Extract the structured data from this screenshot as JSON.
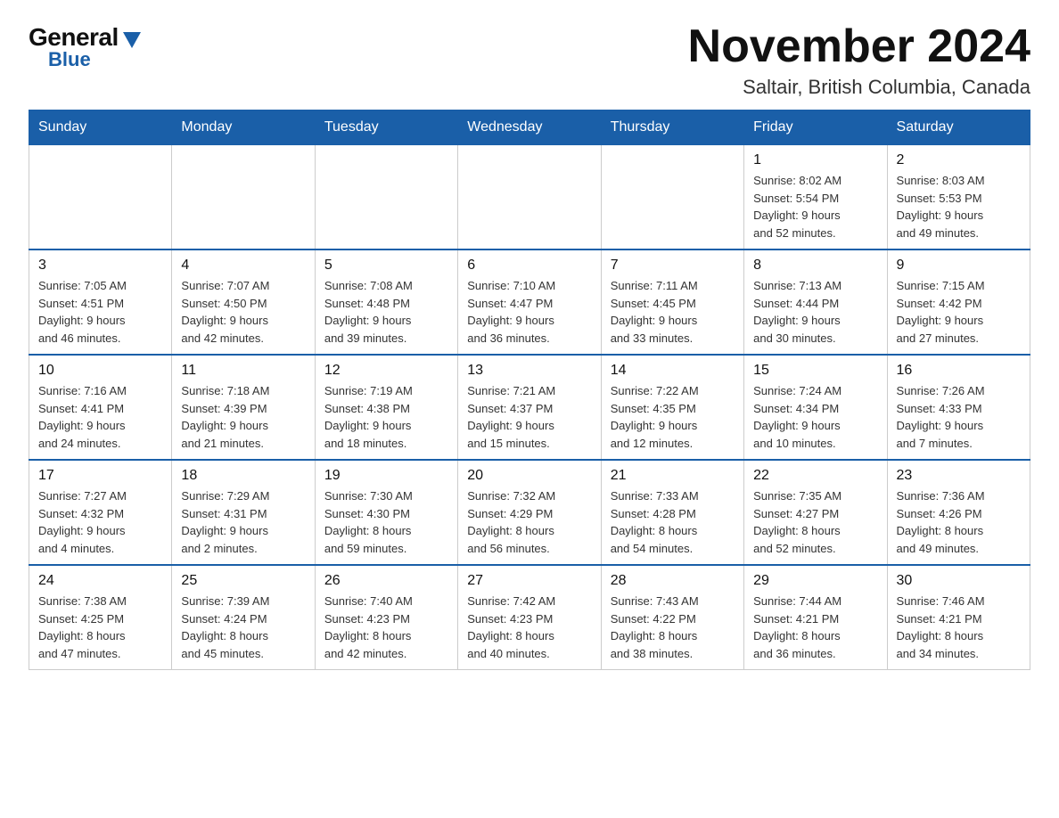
{
  "logo": {
    "general": "General",
    "blue": "Blue"
  },
  "title": {
    "month": "November 2024",
    "location": "Saltair, British Columbia, Canada"
  },
  "weekdays": [
    "Sunday",
    "Monday",
    "Tuesday",
    "Wednesday",
    "Thursday",
    "Friday",
    "Saturday"
  ],
  "weeks": [
    [
      {
        "day": "",
        "info": ""
      },
      {
        "day": "",
        "info": ""
      },
      {
        "day": "",
        "info": ""
      },
      {
        "day": "",
        "info": ""
      },
      {
        "day": "",
        "info": ""
      },
      {
        "day": "1",
        "info": "Sunrise: 8:02 AM\nSunset: 5:54 PM\nDaylight: 9 hours\nand 52 minutes."
      },
      {
        "day": "2",
        "info": "Sunrise: 8:03 AM\nSunset: 5:53 PM\nDaylight: 9 hours\nand 49 minutes."
      }
    ],
    [
      {
        "day": "3",
        "info": "Sunrise: 7:05 AM\nSunset: 4:51 PM\nDaylight: 9 hours\nand 46 minutes."
      },
      {
        "day": "4",
        "info": "Sunrise: 7:07 AM\nSunset: 4:50 PM\nDaylight: 9 hours\nand 42 minutes."
      },
      {
        "day": "5",
        "info": "Sunrise: 7:08 AM\nSunset: 4:48 PM\nDaylight: 9 hours\nand 39 minutes."
      },
      {
        "day": "6",
        "info": "Sunrise: 7:10 AM\nSunset: 4:47 PM\nDaylight: 9 hours\nand 36 minutes."
      },
      {
        "day": "7",
        "info": "Sunrise: 7:11 AM\nSunset: 4:45 PM\nDaylight: 9 hours\nand 33 minutes."
      },
      {
        "day": "8",
        "info": "Sunrise: 7:13 AM\nSunset: 4:44 PM\nDaylight: 9 hours\nand 30 minutes."
      },
      {
        "day": "9",
        "info": "Sunrise: 7:15 AM\nSunset: 4:42 PM\nDaylight: 9 hours\nand 27 minutes."
      }
    ],
    [
      {
        "day": "10",
        "info": "Sunrise: 7:16 AM\nSunset: 4:41 PM\nDaylight: 9 hours\nand 24 minutes."
      },
      {
        "day": "11",
        "info": "Sunrise: 7:18 AM\nSunset: 4:39 PM\nDaylight: 9 hours\nand 21 minutes."
      },
      {
        "day": "12",
        "info": "Sunrise: 7:19 AM\nSunset: 4:38 PM\nDaylight: 9 hours\nand 18 minutes."
      },
      {
        "day": "13",
        "info": "Sunrise: 7:21 AM\nSunset: 4:37 PM\nDaylight: 9 hours\nand 15 minutes."
      },
      {
        "day": "14",
        "info": "Sunrise: 7:22 AM\nSunset: 4:35 PM\nDaylight: 9 hours\nand 12 minutes."
      },
      {
        "day": "15",
        "info": "Sunrise: 7:24 AM\nSunset: 4:34 PM\nDaylight: 9 hours\nand 10 minutes."
      },
      {
        "day": "16",
        "info": "Sunrise: 7:26 AM\nSunset: 4:33 PM\nDaylight: 9 hours\nand 7 minutes."
      }
    ],
    [
      {
        "day": "17",
        "info": "Sunrise: 7:27 AM\nSunset: 4:32 PM\nDaylight: 9 hours\nand 4 minutes."
      },
      {
        "day": "18",
        "info": "Sunrise: 7:29 AM\nSunset: 4:31 PM\nDaylight: 9 hours\nand 2 minutes."
      },
      {
        "day": "19",
        "info": "Sunrise: 7:30 AM\nSunset: 4:30 PM\nDaylight: 8 hours\nand 59 minutes."
      },
      {
        "day": "20",
        "info": "Sunrise: 7:32 AM\nSunset: 4:29 PM\nDaylight: 8 hours\nand 56 minutes."
      },
      {
        "day": "21",
        "info": "Sunrise: 7:33 AM\nSunset: 4:28 PM\nDaylight: 8 hours\nand 54 minutes."
      },
      {
        "day": "22",
        "info": "Sunrise: 7:35 AM\nSunset: 4:27 PM\nDaylight: 8 hours\nand 52 minutes."
      },
      {
        "day": "23",
        "info": "Sunrise: 7:36 AM\nSunset: 4:26 PM\nDaylight: 8 hours\nand 49 minutes."
      }
    ],
    [
      {
        "day": "24",
        "info": "Sunrise: 7:38 AM\nSunset: 4:25 PM\nDaylight: 8 hours\nand 47 minutes."
      },
      {
        "day": "25",
        "info": "Sunrise: 7:39 AM\nSunset: 4:24 PM\nDaylight: 8 hours\nand 45 minutes."
      },
      {
        "day": "26",
        "info": "Sunrise: 7:40 AM\nSunset: 4:23 PM\nDaylight: 8 hours\nand 42 minutes."
      },
      {
        "day": "27",
        "info": "Sunrise: 7:42 AM\nSunset: 4:23 PM\nDaylight: 8 hours\nand 40 minutes."
      },
      {
        "day": "28",
        "info": "Sunrise: 7:43 AM\nSunset: 4:22 PM\nDaylight: 8 hours\nand 38 minutes."
      },
      {
        "day": "29",
        "info": "Sunrise: 7:44 AM\nSunset: 4:21 PM\nDaylight: 8 hours\nand 36 minutes."
      },
      {
        "day": "30",
        "info": "Sunrise: 7:46 AM\nSunset: 4:21 PM\nDaylight: 8 hours\nand 34 minutes."
      }
    ]
  ]
}
